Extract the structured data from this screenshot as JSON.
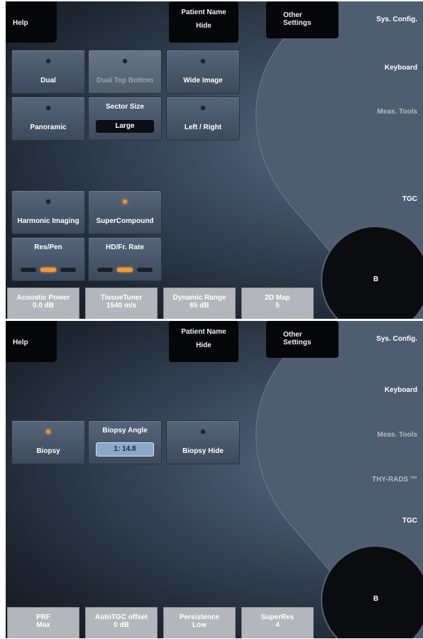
{
  "panel1": {
    "help": "Help",
    "patient_name_label": "Patient Name",
    "patient_name_value": "Hide",
    "other_settings": "Other Settings",
    "right_buttons": [
      "Sys. Config.",
      "Keyboard",
      "Meas. Tools",
      "",
      "TGC"
    ],
    "tiles": [
      {
        "label": "Dual",
        "led": false
      },
      {
        "label": "Dual Top Bottom",
        "led": false
      },
      {
        "label": "Wide Image",
        "led": false
      },
      {
        "label": "Panoramic",
        "led": false
      },
      {
        "label": "Sector Size",
        "value": "Large"
      },
      {
        "label": "Left / Right",
        "led": false
      },
      {
        "label": "Harmonic Imaging",
        "led": false
      },
      {
        "label": "SuperCompound",
        "led": true
      },
      {
        "label": "Res/Pen",
        "slider": "middle"
      },
      {
        "label": "HD/Fr. Rate",
        "slider": "middle"
      }
    ],
    "bottom_buttons": [
      {
        "label": "Acoustic Power",
        "value": "0.0 dB"
      },
      {
        "label": "TissueTuner",
        "value": "1540 m/s"
      },
      {
        "label": "Dynamic Range",
        "value": "65 dB"
      },
      {
        "label": "2D Map",
        "value": "5"
      }
    ],
    "knob": "B"
  },
  "panel2": {
    "help": "Help",
    "patient_name_label": "Patient Name",
    "patient_name_value": "Hide",
    "other_settings": "Other Settings",
    "right_buttons": [
      "Sys. Config.",
      "Keyboard",
      "Meas. Tools",
      "THY-RADS ™",
      "TGC"
    ],
    "tiles": [
      {
        "label": "Biopsy",
        "led": true
      },
      {
        "label": "Biopsy Angle",
        "value": "1: 14.8"
      },
      {
        "label": "Biopsy Hide",
        "led": false
      }
    ],
    "bottom_buttons": [
      {
        "label": "PRF",
        "value": "Max"
      },
      {
        "label": "AutoTGC offset",
        "value": "0 dB"
      },
      {
        "label": "Persistence",
        "value": "Low"
      },
      {
        "label": "SuperRes",
        "value": "4"
      }
    ],
    "knob": "B"
  },
  "colors": {
    "led_on": "#f1932c",
    "selected_value": "#8aa9c8",
    "bottom_bar": "#b3b7bb"
  }
}
